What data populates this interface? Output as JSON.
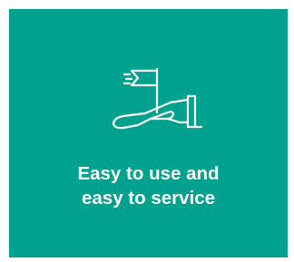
{
  "card": {
    "background": "#00a28f",
    "text_color": "#ffffff",
    "icon": "hand-holding-flag-icon",
    "caption_line1": "Easy to use and",
    "caption_line2": "easy to service"
  }
}
